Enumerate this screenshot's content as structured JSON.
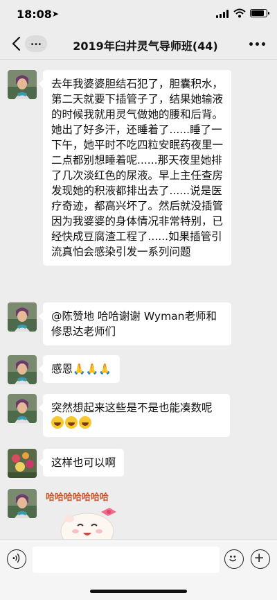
{
  "status": {
    "time": "18:08",
    "location_glyph": "➤"
  },
  "nav": {
    "back_label": "...",
    "title": "2019年臼井灵气导师班(44)"
  },
  "messages": [
    {
      "text": "去年我婆婆胆结石犯了，胆囊积水，第二天就要下插管子了，结果她输液的时候我就用灵气做她的腰和后背。她出了好多汗，还睡着了......睡了一下午，她平时不吃四粒安眠药夜里一二点都别想睡着呢......那天夜里她排了几次淡红色的尿液。早上主任查房发现她的积液都排出去了......说是医疗奇迹，都高兴坏了。然后就没插管因为我婆婆的身体情况非常特别，已经快成豆腐渣工程了......如果插管引流真怕会感染引发一系列问题"
    },
    {
      "text": "@陈赞地 哈哈谢谢 Wyman老师和修思达老师们"
    },
    {
      "text": "感恩",
      "emoji": "🙏🙏🙏"
    },
    {
      "text": "突然想起来这些是不是也能凑数呢"
    },
    {
      "text": "这样也可以啊"
    }
  ],
  "sticker": {
    "text": "哈哈哈哈哈哈哈"
  },
  "input": {
    "placeholder": ""
  }
}
